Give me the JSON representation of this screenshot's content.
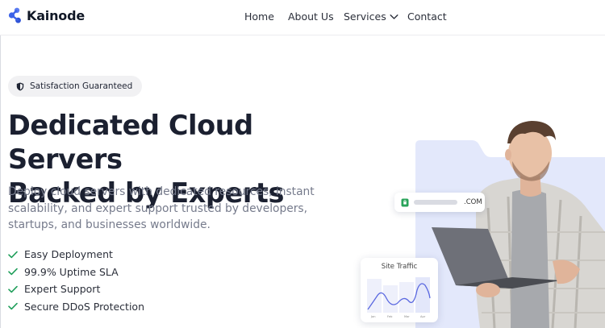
{
  "brand": {
    "name": "Kainode",
    "accent": "#3d63e8"
  },
  "nav": {
    "home": "Home",
    "about": "About Us",
    "services": "Services",
    "contact": "Contact"
  },
  "badge": {
    "icon": "shield-icon",
    "label": "Satisfaction Guaranteed"
  },
  "hero": {
    "headline_line1": "Dedicated Cloud Servers",
    "headline_line2": "Backed by Experts",
    "subtext": "Deploy cloud servers with dedicated resources, instant scalability, and expert support trusted by developers, startups, and businesses worldwide."
  },
  "features": [
    {
      "icon": "check-icon",
      "label": "Easy Deployment"
    },
    {
      "icon": "check-icon",
      "label": "99.9% Uptime SLA"
    },
    {
      "icon": "check-icon",
      "label": "Expert Support"
    },
    {
      "icon": "check-icon",
      "label": "Secure DDoS Protection"
    }
  ],
  "domain_card": {
    "tld": ".COM",
    "icon": "lock-icon"
  },
  "traffic_card": {
    "title": "Site Traffic",
    "months": [
      "Jan",
      "Feb",
      "Mar",
      "Apr"
    ]
  },
  "colors": {
    "check": "#1f9e5a",
    "folder": "#e3e8fb",
    "text_dark": "#1b2030",
    "text_muted": "#767b8c"
  }
}
